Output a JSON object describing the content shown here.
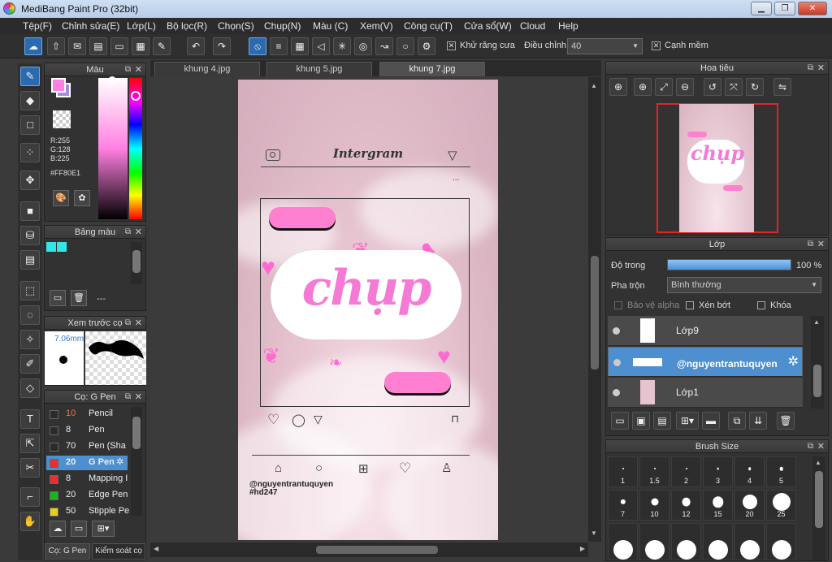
{
  "window": {
    "title": "MediBang Paint Pro (32bit)",
    "min": "▁",
    "max": "❐",
    "close": "✕"
  },
  "menu": [
    "Tệp(F)",
    "Chỉnh sửa(E)",
    "Lớp(L)",
    "Bộ lọc(R)",
    "Chọn(S)",
    "Chụp(N)",
    "Màu (C)",
    "Xem(V)",
    "Công cụ(T)",
    "Cửa sổ(W)",
    "Cloud",
    "Help"
  ],
  "toolbar": {
    "antialias_label": "Khử răng cưa",
    "correction_label": "Điều chỉnh",
    "correction_value": "40",
    "edge_label": "Cạnh mềm"
  },
  "tabs": [
    "khung 4.jpg",
    "khung 5.jpg",
    "khung 7.jpg"
  ],
  "color_panel": {
    "title": "Màu",
    "r": "R:255",
    "g": "G:128",
    "b": "B:225",
    "hex": "#FF80E1",
    "primary": "#ff80e1",
    "secondary": "#a78be0"
  },
  "palette_panel": {
    "title": "Bảng màu",
    "dashes": "---"
  },
  "brush_preview": {
    "title": "Xem trước cọ",
    "size": "7.06mm"
  },
  "brush_panel": {
    "title": "Cọ: G Pen",
    "items": [
      {
        "size": "10",
        "name": "Pencil",
        "color": "#2b2b2b"
      },
      {
        "size": "8",
        "name": "Pen",
        "color": "#2b2b2b"
      },
      {
        "size": "70",
        "name": "Pen (Sha",
        "color": "#2b2b2b"
      },
      {
        "size": "20",
        "name": "G Pen",
        "color": "#e53030"
      },
      {
        "size": "8",
        "name": "Mapping I",
        "color": "#e53030"
      },
      {
        "size": "20",
        "name": "Edge Pen",
        "color": "#1fb21f"
      },
      {
        "size": "50",
        "name": "Stipple Pe",
        "color": "#e6d21e"
      }
    ],
    "bottom_tabs": [
      "Cọ: G Pen",
      "Kiểm soát cọ"
    ]
  },
  "document": {
    "header": "Intergram",
    "more": "...",
    "word": "chụp",
    "username": "@nguyentrantuquyen",
    "hashtag": "#hd247"
  },
  "navigator": {
    "title": "Hoa tiêu"
  },
  "layer_panel": {
    "title": "Lớp",
    "opacity_label": "Độ trong",
    "opacity_value": "100 %",
    "opacity_fraction": 1.0,
    "blend_label": "Pha trộn",
    "blend_value": "Bình thường",
    "protect_alpha": "Bảo vệ alpha",
    "clip": "Xén bớt",
    "lock": "Khóa",
    "layers": [
      "Lớp9",
      "@nguyentrantuquyen",
      "Lớp1"
    ]
  },
  "brush_size_panel": {
    "title": "Brush Size",
    "sizes": [
      "1",
      "1.5",
      "2",
      "3",
      "4",
      "5",
      "7",
      "10",
      "12",
      "15",
      "20",
      "25"
    ]
  }
}
